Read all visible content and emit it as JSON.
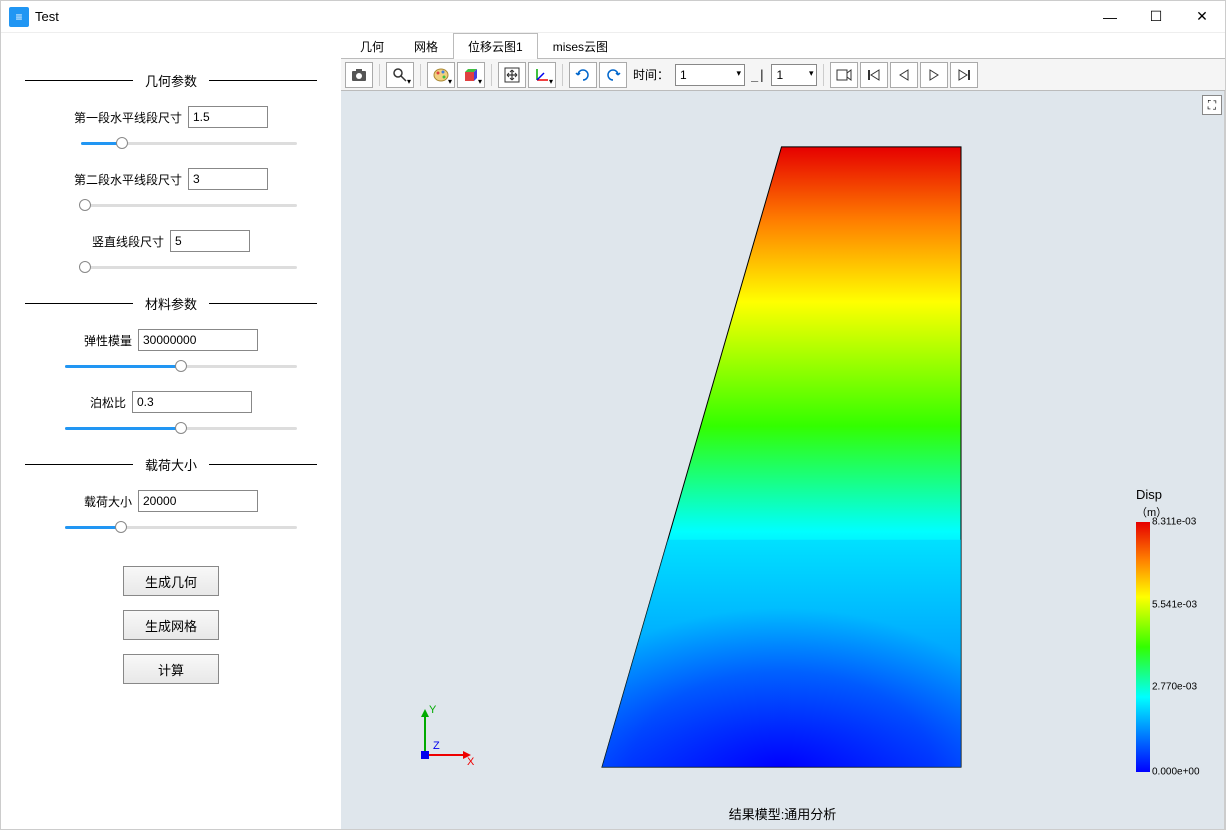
{
  "window": {
    "title": "Test"
  },
  "sidebar": {
    "group_geometry": "几何参数",
    "field1_label": "第一段水平线段尺寸",
    "field1_value": "1.5",
    "field1_pct": 19,
    "field2_label": "第二段水平线段尺寸",
    "field2_value": "3",
    "field2_pct": 2,
    "field3_label": "竖直线段尺寸",
    "field3_value": "5",
    "field3_pct": 2,
    "group_material": "材料参数",
    "field4_label": "弹性模量",
    "field4_value": "30000000",
    "field4_pct": 50,
    "field5_label": "泊松比",
    "field5_value": "0.3",
    "field5_pct": 50,
    "group_load": "载荷大小",
    "field6_label": "载荷大小",
    "field6_value": "20000",
    "field6_pct": 24,
    "btn_gen_geom": "生成几何",
    "btn_gen_mesh": "生成网格",
    "btn_calc": "计算"
  },
  "tabs": {
    "t0": "几何",
    "t1": "网格",
    "t2": "位移云图1",
    "t3": "mises云图"
  },
  "toolbar": {
    "time_label": "时间：",
    "time_value": "1",
    "step_sep": "_|",
    "step_value": "1"
  },
  "viewport": {
    "model_title": "结果模型:通用分析"
  },
  "legend": {
    "title": "Disp",
    "unit": "（m）",
    "v0": "8.311e-03",
    "v1": "5.541e-03",
    "v2": "2.770e-03",
    "v3": "0.000e+00"
  },
  "axes": {
    "x": "X",
    "y": "Y",
    "z": "Z"
  }
}
